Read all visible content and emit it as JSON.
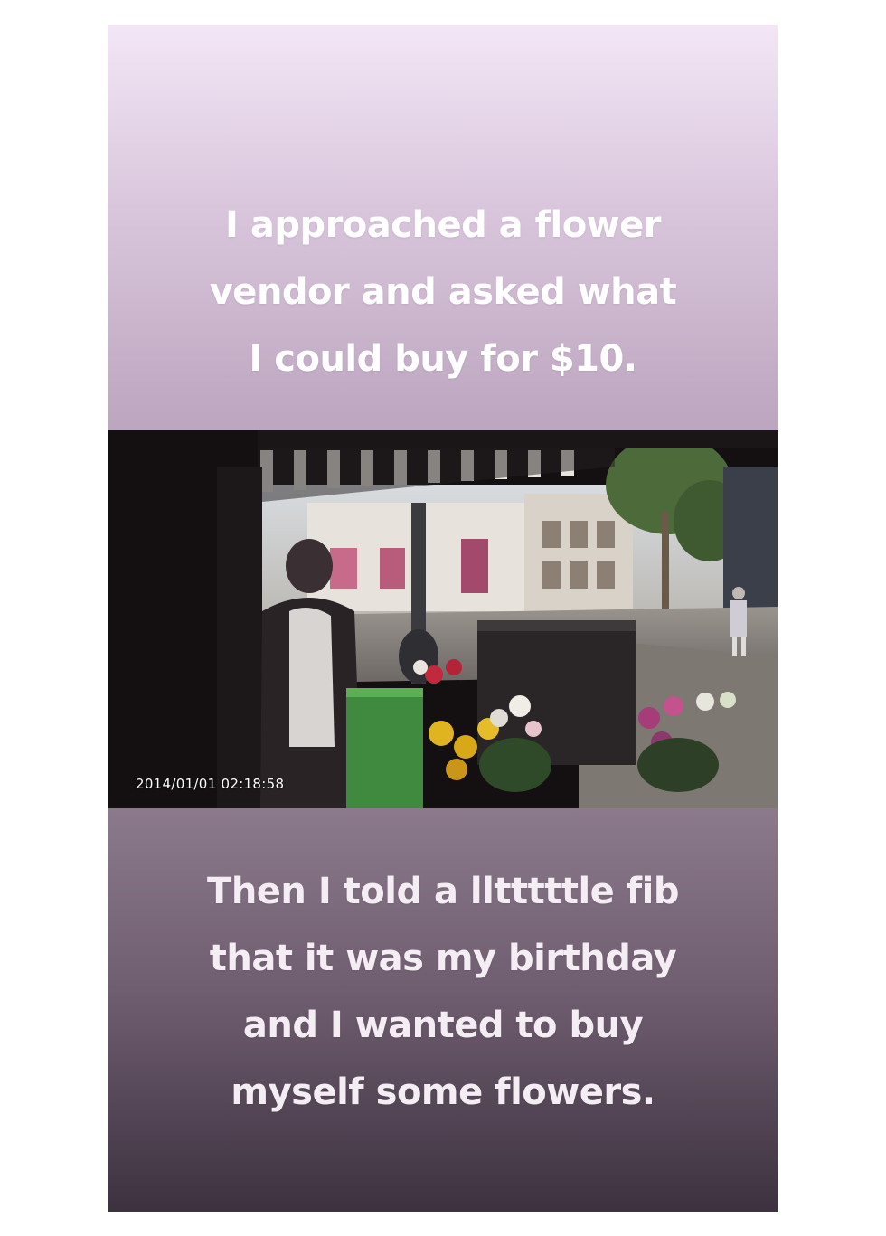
{
  "story": {
    "top_caption": {
      "lines": [
        "I approached a flower",
        "vendor and asked what",
        "I could buy for $10."
      ]
    },
    "video": {
      "timestamp": "2014/01/01  02:18:58"
    },
    "bottom_caption": {
      "lines": [
        "Then I told a lltttttle fib",
        "that it was my birthday",
        "and I wanted to buy",
        "myself some flowers."
      ]
    }
  },
  "colors": {
    "top_panel": "#d9c6dc",
    "bottom_panel": "#6f5e70",
    "caption_text": "#ffffff"
  }
}
